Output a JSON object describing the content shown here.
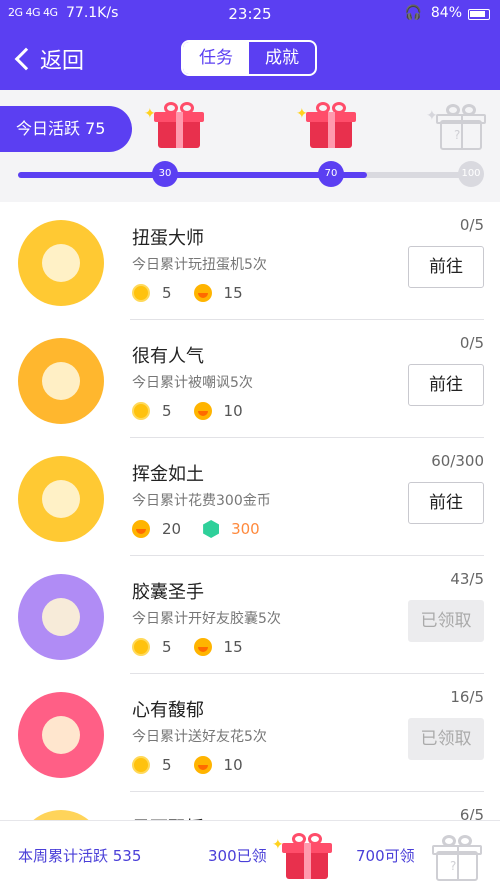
{
  "status_bar": {
    "signal": "2G 4G 4G",
    "net_speed": "77.1K/s",
    "time": "23:25",
    "battery": "84%",
    "headphone_icon": "headphone-icon"
  },
  "nav": {
    "back_label": "返回",
    "tabs": [
      {
        "label": "任务",
        "active": true
      },
      {
        "label": "成就",
        "active": false
      }
    ]
  },
  "activity": {
    "label": "今日活跃 75",
    "value": 75,
    "max": 100,
    "milestones": [
      "30",
      "70",
      "100"
    ]
  },
  "tasks": [
    {
      "title": "扭蛋大师",
      "desc": "今日累计玩扭蛋机5次",
      "progress": "0/5",
      "rewards": [
        {
          "icon": "gold-coin-icon",
          "value": "5"
        },
        {
          "icon": "orange-bean-icon",
          "value": "15"
        }
      ],
      "button": "前往",
      "done": false,
      "color": "#ffc933"
    },
    {
      "title": "很有人气",
      "desc": "今日累计被嘲讽5次",
      "progress": "0/5",
      "rewards": [
        {
          "icon": "gold-coin-icon",
          "value": "5"
        },
        {
          "icon": "orange-bean-icon",
          "value": "10"
        }
      ],
      "button": "前往",
      "done": false,
      "color": "#ffb72e"
    },
    {
      "title": "挥金如土",
      "desc": "今日累计花费300金币",
      "progress": "60/300",
      "rewards": [
        {
          "icon": "orange-bean-icon",
          "value": "20"
        },
        {
          "icon": "green-gem-icon",
          "value": "300"
        }
      ],
      "button": "前往",
      "done": false,
      "color": "#ffc933"
    },
    {
      "title": "胶囊圣手",
      "desc": "今日累计开好友胶囊5次",
      "progress": "43/5",
      "rewards": [
        {
          "icon": "gold-coin-icon",
          "value": "5"
        },
        {
          "icon": "orange-bean-icon",
          "value": "15"
        }
      ],
      "button": "已领取",
      "done": true,
      "color": "#b08cf5"
    },
    {
      "title": "心有馥郁",
      "desc": "今日累计送好友花5次",
      "progress": "16/5",
      "rewards": [
        {
          "icon": "gold-coin-icon",
          "value": "5"
        },
        {
          "icon": "orange-bean-icon",
          "value": "10"
        }
      ],
      "button": "已领取",
      "done": true,
      "color": "#ff5f86"
    },
    {
      "title": "风雨飘摇",
      "desc": "",
      "progress": "6/5",
      "rewards": [],
      "button": "",
      "done": true,
      "color": "#ffd45a"
    }
  ],
  "footer": {
    "weekly_label": "本周累计活跃 535",
    "claimed_label": "300已领",
    "available_label": "700可领"
  },
  "colors": {
    "accent": "#5b3ff2",
    "gift": "#e8304d"
  }
}
